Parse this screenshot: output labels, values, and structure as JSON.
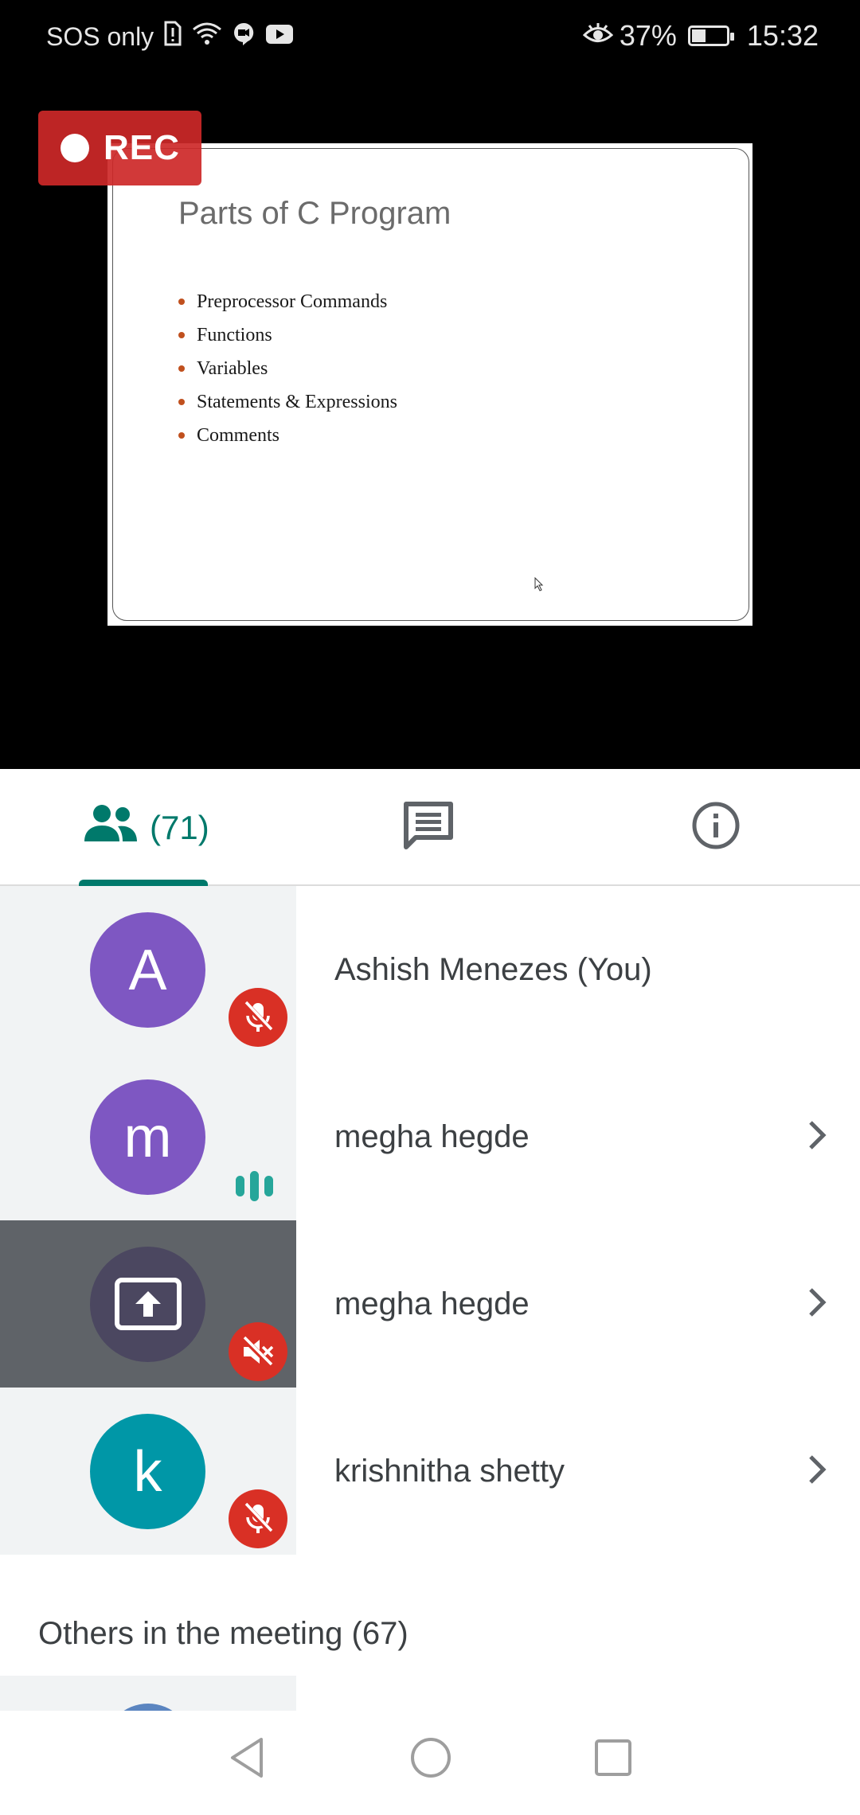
{
  "status_bar": {
    "carrier": "SOS only",
    "battery": "37%",
    "time": "15:32"
  },
  "recording": {
    "label": "REC"
  },
  "slide": {
    "title": "Parts of C Program",
    "bullets": [
      "Preprocessor Commands",
      "Functions",
      "Variables",
      "Statements & Expressions",
      "Comments"
    ]
  },
  "tabs": {
    "people_count": "(71)",
    "active": "people"
  },
  "participants": [
    {
      "initial": "A",
      "name": "Ashish Menezes (You)",
      "status": "muted"
    },
    {
      "initial": "m",
      "name": "megha hegde",
      "status": "speaking"
    },
    {
      "initial": "",
      "name": "megha hegde",
      "status": "presenting-muted"
    },
    {
      "initial": "k",
      "name": "krishnitha shetty",
      "status": "muted"
    }
  ],
  "others_heading": "Others in the meeting (67)",
  "colors": {
    "accent": "#00796b",
    "avatar_purple": "#7e57c2",
    "avatar_teal": "#0097a7",
    "mute_red": "#d93025",
    "rec_red": "#cd2828"
  }
}
